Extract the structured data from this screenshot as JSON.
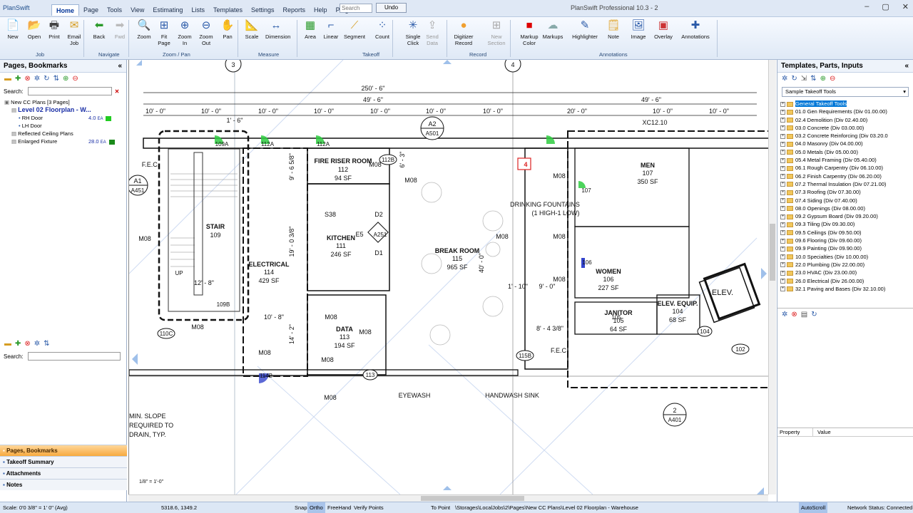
{
  "app": {
    "logo": "PlanSwift",
    "title": "PlanSwift Professional 10.3 - 2",
    "search_placeholder": "Search",
    "undo": "Undo"
  },
  "menus": [
    "Home",
    "Page",
    "Tools",
    "View",
    "Estimating",
    "Lists",
    "Templates",
    "Settings",
    "Reports",
    "Help",
    "Plugins"
  ],
  "ribbon": {
    "groups": [
      "Job",
      "Navigate",
      "Zoom / Pan",
      "Measure",
      "Takeoff",
      "Record",
      "Annotations"
    ],
    "tools": [
      {
        "label": "New",
        "icon": "new-file-icon"
      },
      {
        "label": "Open",
        "icon": "open-folder-icon"
      },
      {
        "label": "Print",
        "icon": "printer-icon"
      },
      {
        "label": "Email\nJob",
        "icon": "email-icon"
      },
      {
        "label": "Back",
        "icon": "back-arrow-icon"
      },
      {
        "label": "Fwd",
        "icon": "forward-arrow-icon"
      },
      {
        "label": "Zoom",
        "icon": "zoom-icon"
      },
      {
        "label": "Fit\nPage",
        "icon": "fit-page-icon"
      },
      {
        "label": "Zoom\nIn",
        "icon": "zoom-in-icon"
      },
      {
        "label": "Zoom\nOut",
        "icon": "zoom-out-icon"
      },
      {
        "label": "Pan",
        "icon": "pan-hand-icon"
      },
      {
        "label": "Scale",
        "icon": "scale-icon"
      },
      {
        "label": "Dimension",
        "icon": "dimension-icon"
      },
      {
        "label": "Area",
        "icon": "area-icon"
      },
      {
        "label": "Linear",
        "icon": "linear-icon"
      },
      {
        "label": "Segment",
        "icon": "segment-icon"
      },
      {
        "label": "Count",
        "icon": "count-icon"
      },
      {
        "label": "Single\nClick",
        "icon": "single-click-icon"
      },
      {
        "label": "Send\nData",
        "icon": "send-data-icon"
      },
      {
        "label": "Digitizer\nRecord",
        "icon": "digitizer-icon"
      },
      {
        "label": "New\nSection",
        "icon": "new-section-icon"
      },
      {
        "label": "Markup\nColor",
        "icon": "markup-color-icon"
      },
      {
        "label": "Markups",
        "icon": "markups-cloud-icon"
      },
      {
        "label": "Highlighter",
        "icon": "highlighter-icon"
      },
      {
        "label": "Note",
        "icon": "note-icon"
      },
      {
        "label": "Image",
        "icon": "image-icon"
      },
      {
        "label": "Overlay",
        "icon": "overlay-icon"
      },
      {
        "label": "Annotations",
        "icon": "annotations-icon"
      }
    ]
  },
  "left_panel": {
    "title": "Pages, Bookmarks",
    "search_label": "Search:",
    "tree": [
      {
        "label": "New CC Plans [3 Pages]",
        "level": 0
      },
      {
        "label": "Level 02 Floorplan - W...",
        "level": 1,
        "selected": true
      },
      {
        "label": "RH Door",
        "level": 2,
        "qty": "4.0",
        "unit": "EA",
        "color": "#22cc22"
      },
      {
        "label": "LH Door",
        "level": 2,
        "qty": "",
        "unit": "",
        "color": ""
      },
      {
        "label": "Reflected Ceiling Plans",
        "level": 1
      },
      {
        "label": "Enlarged Fixture",
        "level": 1,
        "qty": "28.0",
        "unit": "EA",
        "color": "#1a8a1a"
      }
    ],
    "bottom_search_label": "Search:",
    "accordion": [
      "Pages, Bookmarks",
      "Takeoff Summary",
      "Attachments",
      "Notes"
    ]
  },
  "right_panel": {
    "title": "Templates, Parts, Inputs",
    "dropdown": "Sample Takeoff Tools",
    "items": [
      "General Takeoff Tools",
      "01.0 Gen Requirements (Div 01.00.00)",
      "02.4 Demolition (Div 02.40.00)",
      "03.0 Concrete (Div 03.00.00)",
      "03.2 Concrete Reinforcing (Div 03.20.0",
      "04.0 Masonry (Div 04.00.00)",
      "05.0 Metals (Div 05.00.00)",
      "05.4 Metal Framing (Div 05.40.00)",
      "06.1 Rough Carpentry (Div 06.10.00)",
      "06.2 Finish Carpentry (Div 06.20.00)",
      "07.2 Thermal Insulation (Div 07.21.00)",
      "07.3 Roofing (Div 07.30.00)",
      "07.4 Siding (Div 07.40.00)",
      "08.0 Openings (Div 08.00.00)",
      "09.2 Gypsum Board (Div 09.20.00)",
      "09.3 Tiling (Div 09.30.00)",
      "09.5 Ceilings (Div 09.50.00)",
      "09.6 Flooring (Div 09.60.00)",
      "09.9 Painting (Div 09.90.00)",
      "10.0 Specialties (Div 10.00.00)",
      "22.0 Plumbing (Div 22.00.00)",
      "23.0 HVAC (Div 23.00.00)",
      "26.0 Electrical (Div 26.00.00)",
      "32.1 Paving and Bases (Div 32.10.00)"
    ],
    "prop_headers": [
      "Property",
      "Value"
    ]
  },
  "plan": {
    "dims_top": [
      "250' - 6\"",
      "49' - 6\"",
      "49' - 6\""
    ],
    "dims_row": [
      "10' - 0\"",
      "10' - 0\"",
      "10' - 0\"",
      "10' - 0\"",
      "10' - 0\"",
      "10' - 0\"",
      "10' - 0\"",
      "20' - 0\"",
      "10' - 0\"",
      "10' - 0\"",
      "10' - 0\""
    ],
    "grid_bubbles": [
      "3",
      "4"
    ],
    "section_tags": [
      {
        "num": "A2",
        "ref": "A501"
      },
      {
        "num": "A1",
        "ref": "A451"
      },
      {
        "num": "2",
        "ref": "A401"
      }
    ],
    "rooms": [
      {
        "name": "STAIR",
        "num": "109",
        "area": ""
      },
      {
        "name": "ELECTRICAL",
        "num": "114",
        "area": "429 SF"
      },
      {
        "name": "FIRE RISER ROOM",
        "num": "112",
        "area": "94 SF"
      },
      {
        "name": "KITCHEN",
        "num": "111",
        "area": "246 SF"
      },
      {
        "name": "BREAK ROOM",
        "num": "115",
        "area": "965 SF"
      },
      {
        "name": "DATA",
        "num": "113",
        "area": "194 SF"
      },
      {
        "name": "MEN",
        "num": "107",
        "area": "350 SF"
      },
      {
        "name": "WOMEN",
        "num": "106",
        "area": "227 SF"
      },
      {
        "name": "JANITOR",
        "num": "105",
        "area": "64 SF"
      },
      {
        "name": "ELEV. EQUIP.",
        "num": "104",
        "area": "68 SF"
      }
    ],
    "labels": {
      "m08": "M08",
      "fec": "F.E.C.",
      "fec2": "F.E.C",
      "xc": "XC12.10",
      "drink1": "DRINKING FOUNTAINS",
      "drink2": "(1 HIGH-1 LOW)",
      "eyewash": "EYEWASH",
      "sink": "HANDWASH SINK",
      "elev": "ELEV.",
      "up": "UP",
      "s38": "S38",
      "d2": "D2",
      "d1": "D1",
      "e5": "E5",
      "a251": "A251",
      "tag4": "4",
      "slope1": "MIN. SLOPE",
      "slope2": "REQUIRED TO",
      "slope3": "DRAIN, TYP.",
      "d1r": "12' - 8\"",
      "d2r": "10' - 8\"",
      "d3r": "9' - 6 5/8\"",
      "d4r": "19' - 0 3/8\"",
      "d5r": "14' - 2\"",
      "d6r": "40' - 0\"",
      "d7r": "1' - 10\"",
      "d8r": "9' - 0\"",
      "d9r": "8' - 4 3/8\"",
      "d10r": "1' - 6\"",
      "d11r": "6' - 3\"",
      "d12r": "1/8\" = 1'-0\"",
      "doors": [
        "109A",
        "112A",
        "112A",
        "112B",
        "108",
        "109B",
        "110C",
        "114B",
        "113",
        "115B",
        "107",
        "106",
        "105",
        "104",
        "102"
      ]
    }
  },
  "status": {
    "scale": "Scale: 0'0 3/8\" = 1' 0\" (Avg)",
    "coords": "5318.6, 1349.2",
    "toggles": [
      "Snap",
      "Ortho",
      "FreeHand",
      "Verify Points"
    ],
    "to_point": "To Point",
    "path": "\\Storages\\LocalJobs\\2\\Pages\\New CC Plans\\Level 02 Floorplan - Warehouse",
    "autoscroll": "AutoScroll",
    "network": "Network Status: Connected"
  }
}
